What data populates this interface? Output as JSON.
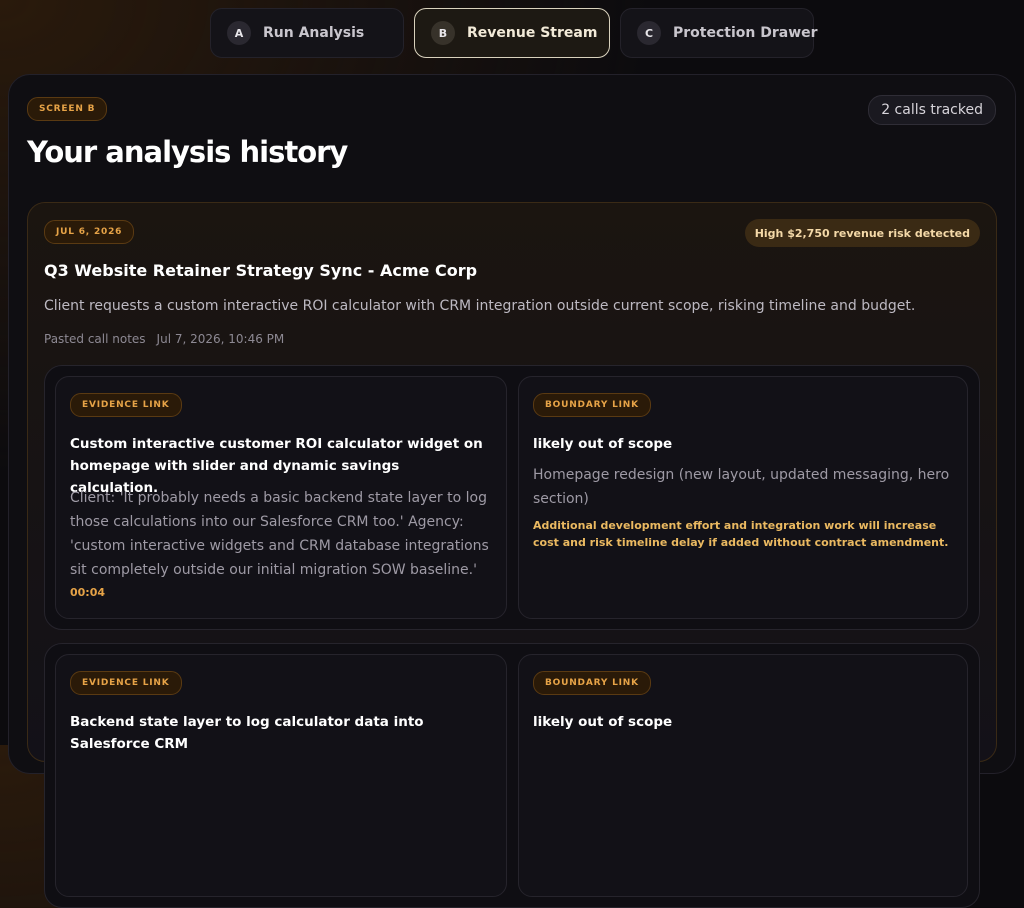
{
  "tabs": [
    {
      "letter": "A",
      "label": "Run Analysis"
    },
    {
      "letter": "B",
      "label": "Revenue Stream"
    },
    {
      "letter": "C",
      "label": "Protection Drawer"
    }
  ],
  "screen_badge": "SCREEN B",
  "calls_tracked": "2 calls tracked",
  "page_title": "Your analysis history",
  "analysis": {
    "date": "JUL 6, 2026",
    "risk_badge": "High $2,750 revenue risk detected",
    "title": "Q3 Website Retainer Strategy Sync - Acme Corp",
    "summary": "Client requests a custom interactive ROI calculator with CRM integration outside current scope, risking timeline and budget.",
    "source": "Pasted call notes",
    "timestamp": "Jul 7, 2026, 10:46 PM",
    "links": [
      {
        "evidence_label": "EVIDENCE LINK",
        "evidence_title": "Custom interactive customer ROI calculator widget on homepage with slider and dynamic savings calculation.",
        "evidence_quote": "Client: 'It probably needs a basic backend state layer to log those calculations into our Salesforce CRM too.' Agency: 'custom interactive widgets and CRM database integrations sit completely outside our initial migration SOW baseline.'",
        "evidence_time": "00:04",
        "boundary_label": "BOUNDARY LINK",
        "boundary_status": "likely out of scope",
        "boundary_scope": "Homepage redesign (new layout, updated messaging, hero section)",
        "boundary_impact": "Additional development effort and integration work will increase cost and risk timeline delay if added without contract amendment."
      },
      {
        "evidence_label": "EVIDENCE LINK",
        "evidence_title": "Backend state layer to log calculator data into Salesforce CRM",
        "boundary_label": "BOUNDARY LINK",
        "boundary_status": "likely out of scope"
      }
    ]
  }
}
